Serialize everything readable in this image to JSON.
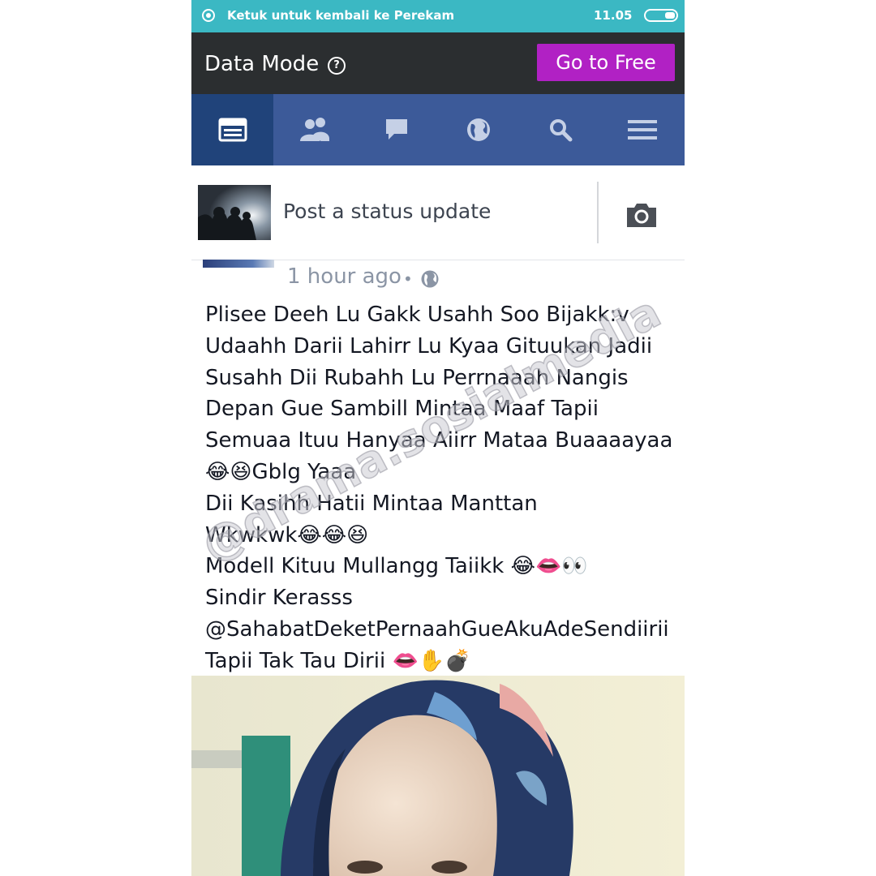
{
  "status_bar": {
    "message": "Ketuk untuk kembali ke Perekam",
    "time": "11.05"
  },
  "data_mode": {
    "title": "Data Mode",
    "help_icon_text": "?",
    "go_free_label": "Go to Free"
  },
  "nav": {
    "tabs": [
      {
        "icon": "news-feed-icon",
        "active": true
      },
      {
        "icon": "friends-icon",
        "active": false
      },
      {
        "icon": "messages-icon",
        "active": false
      },
      {
        "icon": "globe-notifications-icon",
        "active": false
      },
      {
        "icon": "search-icon",
        "active": false
      },
      {
        "icon": "menu-icon",
        "active": false
      }
    ]
  },
  "composer": {
    "placeholder": "Post a status update"
  },
  "post": {
    "time": "1 hour ago",
    "separator": "•",
    "lines": [
      "Plisee Deeh Lu Gakk Usahh Soo Bijakk:v",
      "Udaahh Darii Lahirr Lu Kyaa Gituukan Jadii",
      "Susahh Dii Rubahh Lu Perrnaaah Nangis",
      "Depan Gue Sambill Mintaa Maaf Tapii",
      "Semuaa Ituu Hanyaa Aiirr Mataa Buaaaayaa",
      "😂😆Gblg Yaaa",
      "Dii Kasihh Hatii Mintaa Manttan",
      "Wkwkwk😂😂😆",
      "Modell Kituu Mullangg Taiikk 😂👄👀",
      "Sindir Kerasss",
      "@SahabatDeketPernaahGueAkuAdeSendiirii",
      "Tapii Tak Tau Dirii 👄✋💣"
    ]
  },
  "watermark": {
    "text": "@drama.sosialmedia"
  },
  "colors": {
    "status_bar": "#3bb8c3",
    "data_bar": "#2b2e30",
    "go_free_button": "#b121c4",
    "nav_bar": "#3c5a99",
    "nav_active": "#20437a",
    "meta_text": "#8b95a5"
  }
}
